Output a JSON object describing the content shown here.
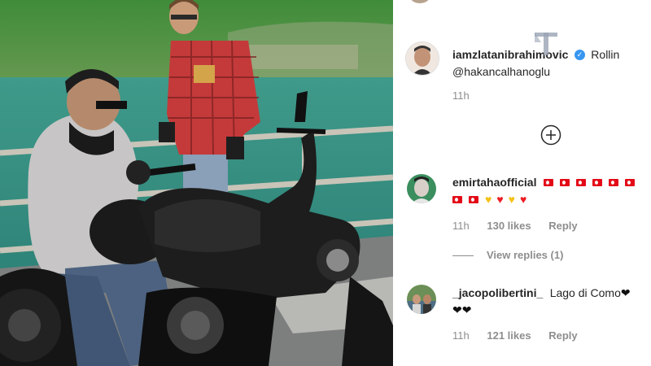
{
  "caption": {
    "username": "iamzlatanibrahimovic",
    "text": "Rollin",
    "mention": "@hakancalhanoglu",
    "time": "11h",
    "verified_icon": "verified-badge-icon",
    "watermark_icon": "telemundo-watermark-icon"
  },
  "load_more_icon": "plus-circle-icon",
  "comments": [
    {
      "username": "emirtahaofficial",
      "emoji": [
        "turkey-flag",
        "turkey-flag",
        "turkey-flag",
        "turkey-flag",
        "turkey-flag",
        "turkey-flag",
        "turkey-flag",
        "turkey-flag",
        "yellow-heart",
        "red-heart",
        "yellow-heart",
        "red-heart"
      ],
      "time": "11h",
      "likes": "130 likes",
      "reply": "Reply",
      "view_replies": "View replies (1)"
    },
    {
      "username": "_jacopolibertini_",
      "text": "Lago di Como",
      "emoji": [
        "black-heart",
        "black-heart",
        "black-heart"
      ],
      "time": "11h",
      "likes": "121 likes",
      "reply": "Reply"
    }
  ],
  "colors": {
    "verified": "#3897f0",
    "text": "#262626",
    "meta": "#8e8e8e",
    "flag_red": "#e30a17",
    "heart_red": "#ed1c24",
    "heart_yellow": "#f5c116"
  }
}
